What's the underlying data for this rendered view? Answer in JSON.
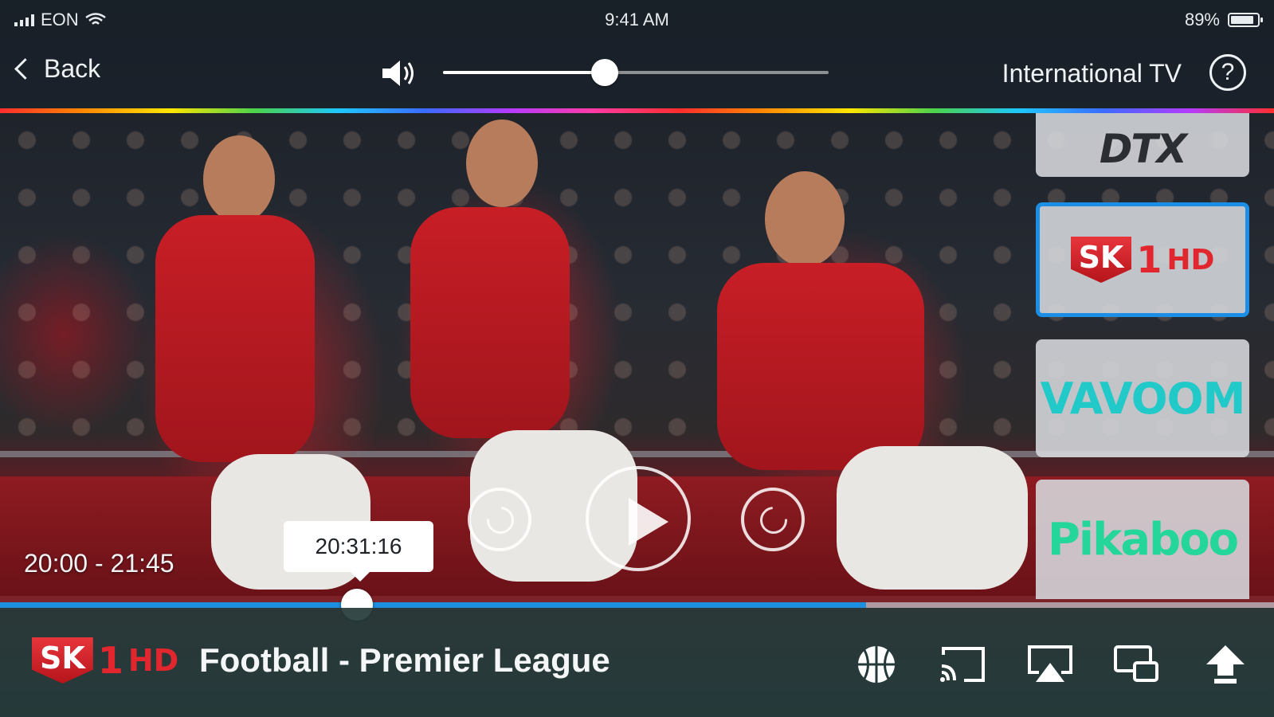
{
  "status_bar": {
    "carrier": "EON",
    "time": "9:41 AM",
    "battery": "89%",
    "battery_level": 0.89,
    "icons": [
      "signal-icon",
      "wifi-icon",
      "battery-icon"
    ]
  },
  "top_bar": {
    "back_label": "Back",
    "volume_level": 0.42,
    "section_title": "International TV",
    "help_label": "?"
  },
  "channels": [
    {
      "name": "DTX",
      "logo_text": "DTX",
      "selected": false
    },
    {
      "name": "SK1 HD",
      "logo_shield": "SK",
      "logo_num": "1",
      "logo_hd": "HD",
      "selected": true
    },
    {
      "name": "Vavoom",
      "logo_text": "VAVOOM",
      "selected": false
    },
    {
      "name": "Pikaboo",
      "logo_text": "Pikaboo",
      "selected": false
    }
  ],
  "player": {
    "time_range": "20:00 - 21:45",
    "scrub_time": "20:31:16",
    "progress": 0.28,
    "buffered": 0.68
  },
  "bottom_bar": {
    "channel_logo": {
      "shield": "SK",
      "num": "1",
      "hd": "HD"
    },
    "program_title": "Football - Premier League",
    "actions": [
      "sport-category-icon",
      "cast-icon",
      "airplay-icon",
      "multiscreen-icon",
      "share-icon"
    ]
  },
  "colors": {
    "accent_blue": "#1c8ee6",
    "brand_red": "#e1262e",
    "bottom_bar": "#243a3a"
  }
}
